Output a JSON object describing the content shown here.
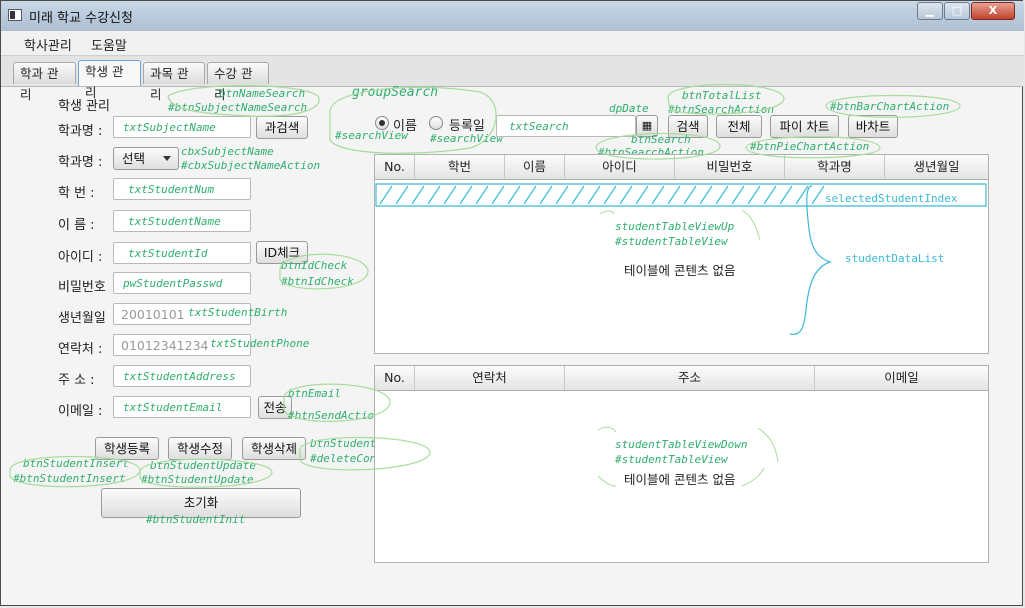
{
  "window": {
    "title": "미래 학교 수강신청",
    "controls": {
      "minimize": "▁",
      "maximize": "□",
      "close": "X"
    }
  },
  "menu": [
    "학사관리",
    "도움말"
  ],
  "tabs": [
    "학과 관리",
    "학생 관리",
    "과목 관리",
    "수강 관리"
  ],
  "form": {
    "section_title": "학생 관리",
    "labels": {
      "subject_name": "학과명 :",
      "subject_select": "학과명 :",
      "student_num": "학 번 :",
      "student_name": "이 름 :",
      "student_id": "아이디 :",
      "password": "비밀번호",
      "birth": "생년월일",
      "phone": "연락처 :",
      "address": "주 소 :",
      "email": "이메일 :"
    },
    "subject_select_value": "선택",
    "buttons": {
      "name_search": "과검색",
      "id_check": "ID체크",
      "send": "전송",
      "insert": "학생등록",
      "update": "학생수정",
      "delete": "학생삭제",
      "init": "초기화"
    },
    "placeholders": {
      "birth": "20010101",
      "phone": "01012341234"
    },
    "annotations": {
      "txt_subject_name": "txtSubjectName",
      "cbx_subject_name": "cbxSubjectName",
      "cbx_subject_name_action": "#cbxSubjectNameAction",
      "txt_student_num": "txtStudentNum",
      "txt_student_name": "txtStudentName",
      "txt_student_id": "txtStudentId",
      "pw_student_passwd": "pwStudentPasswd",
      "txt_student_birth": "txtStudentBirth",
      "txt_student_phone": "txtStudentPhone",
      "txt_student_address": "txtStudentAddress",
      "txt_student_email": "txtStudentEmail",
      "btn_name_search": "btnNameSearch",
      "btn_subject_name_search": "#btnSubjectNameSearch",
      "btn_id_check": "btnIdCheck",
      "btn_id_check_action": "#btnIdCheck",
      "btn_email": "btnEmail",
      "btn_send_action": "#btnSendAction",
      "btn_student_delete": "btnStudentDelete",
      "delete_confirm": "#deleteConfirm",
      "btn_student_insert": "btnStudentInsert",
      "btn_student_insert_action": "#btnStudentInsert",
      "btn_student_update": "btnStudentUpdate",
      "btn_student_update_action": "#btnStudentUpdate",
      "btn_student_init": "#btnStudentInit"
    }
  },
  "search": {
    "radio_name": "이름",
    "radio_date": "등록일",
    "calendar_icon": "▦",
    "buttons": {
      "search": "검색",
      "total": "전체",
      "pie_chart": "파이 차트",
      "bar_chart": "바차트"
    },
    "annotations": {
      "group_search": "groupSearch",
      "search_view_1": "#searchView",
      "search_view_2": "#searchView",
      "txt_search": "txtSearch",
      "dp_date": "dpDate",
      "btn_total_list": "btnTotalList",
      "btn_search_action_1": "#btnSearchAction",
      "btn_search": "btnSearch",
      "btn_search_action_2": "#btnSearchAction",
      "btn_pie_chart_action": "#btnPieChartAction",
      "btn_bar_chart_action": "#btnBarChartAction"
    }
  },
  "table_up": {
    "columns": [
      "No.",
      "학번",
      "이름",
      "아이디",
      "비밀번호",
      "학과명",
      "생년월일"
    ],
    "empty_text": "테이블에 콘텐츠 없음",
    "annotations": {
      "view": "studentTableViewUp",
      "id": "#studentTableView",
      "selected_index": "selectedStudentIndex",
      "data_list": "studentDataList"
    }
  },
  "table_down": {
    "columns": [
      "No.",
      "연락처",
      "주소",
      "이메일"
    ],
    "empty_text": "테이블에 콘텐츠 없음",
    "annotations": {
      "view": "studentTableViewDown",
      "id": "#studentTableView"
    }
  },
  "colors": {
    "annotation_green": "#2fae6e",
    "annotation_blue": "#3ab9d6",
    "active_tab_border": "#6ea4d8"
  }
}
